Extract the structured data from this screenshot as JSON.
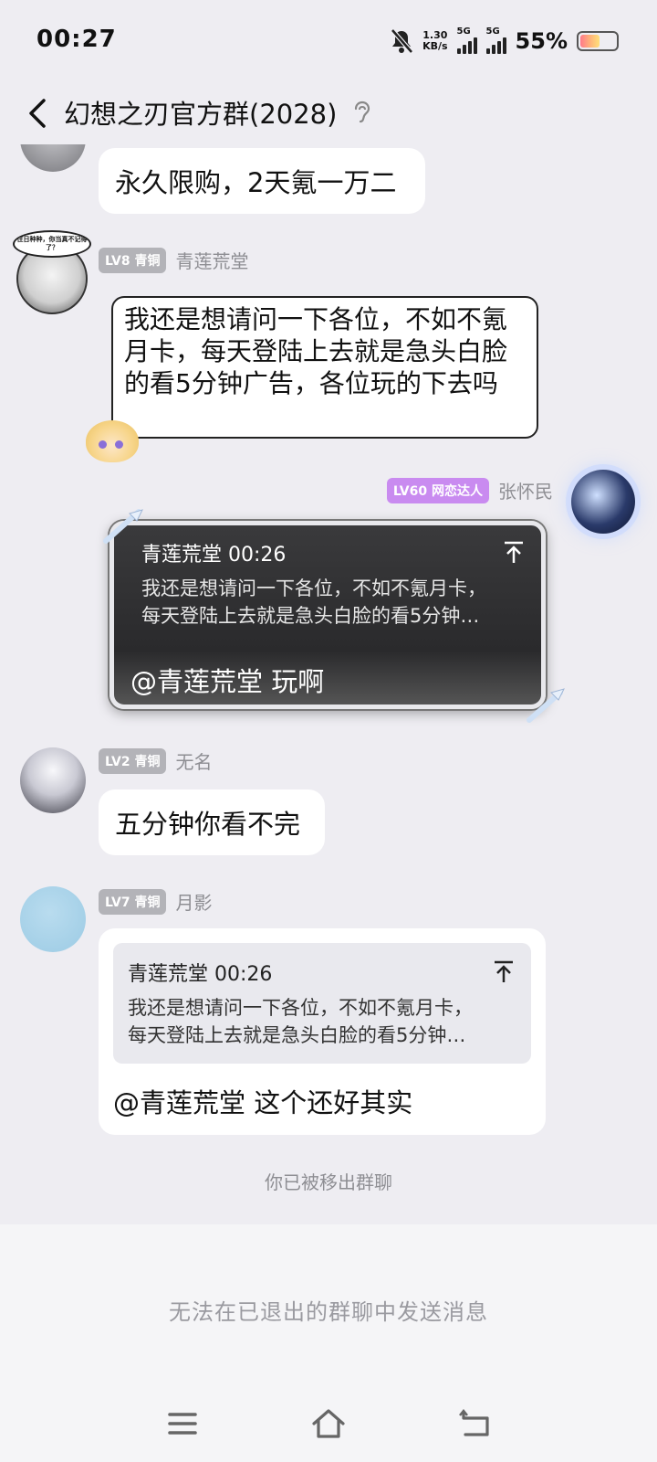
{
  "status": {
    "time": "00:27",
    "net_speed_value": "1.30",
    "net_speed_unit": "KB/s",
    "sim1": "5G",
    "sim2": "5G",
    "battery": "55%",
    "battery_level": 0.55,
    "icons": [
      "mute-bell-icon",
      "signal-icon",
      "battery-icon"
    ]
  },
  "header": {
    "title": "幻想之刃官方群(2028)",
    "icons": [
      "back-arrow-icon",
      "ear-icon"
    ]
  },
  "messages": [
    {
      "text": "永久限购，2天氪一万二"
    },
    {
      "level": "LV8 青铜",
      "name": "青莲荒堂",
      "avatar_caption": "往日种种，你当真不记得了？",
      "text": "我还是想请问一下各位，不如不氪月卡，每天登陆上去就是急头白脸的看5分钟广告，各位玩的下去吗"
    },
    {
      "level": "LV60 网恋达人",
      "name": "张怀民",
      "quote_header": "青莲荒堂 00:26",
      "quote_line1": "我还是想请问一下各位，不如不氪月卡，",
      "quote_line2": "每天登陆上去就是急头白脸的看5分钟…",
      "text": "@青莲荒堂 玩啊"
    },
    {
      "level": "LV2 青铜",
      "name": "无名",
      "text": "五分钟你看不完"
    },
    {
      "level": "LV7 青铜",
      "name": "月影",
      "quote_header": "青莲荒堂 00:26",
      "quote_line1": "我还是想请问一下各位，不如不氪月卡，",
      "quote_line2": "每天登陆上去就是急头白脸的看5分钟…",
      "text": "@青莲荒堂 这个还好其实"
    }
  ],
  "system_message": "你已被移出群聊",
  "bottom_hint": "无法在已退出的群聊中发送消息",
  "nav_icons": [
    "menu-icon",
    "home-icon",
    "back-icon"
  ]
}
